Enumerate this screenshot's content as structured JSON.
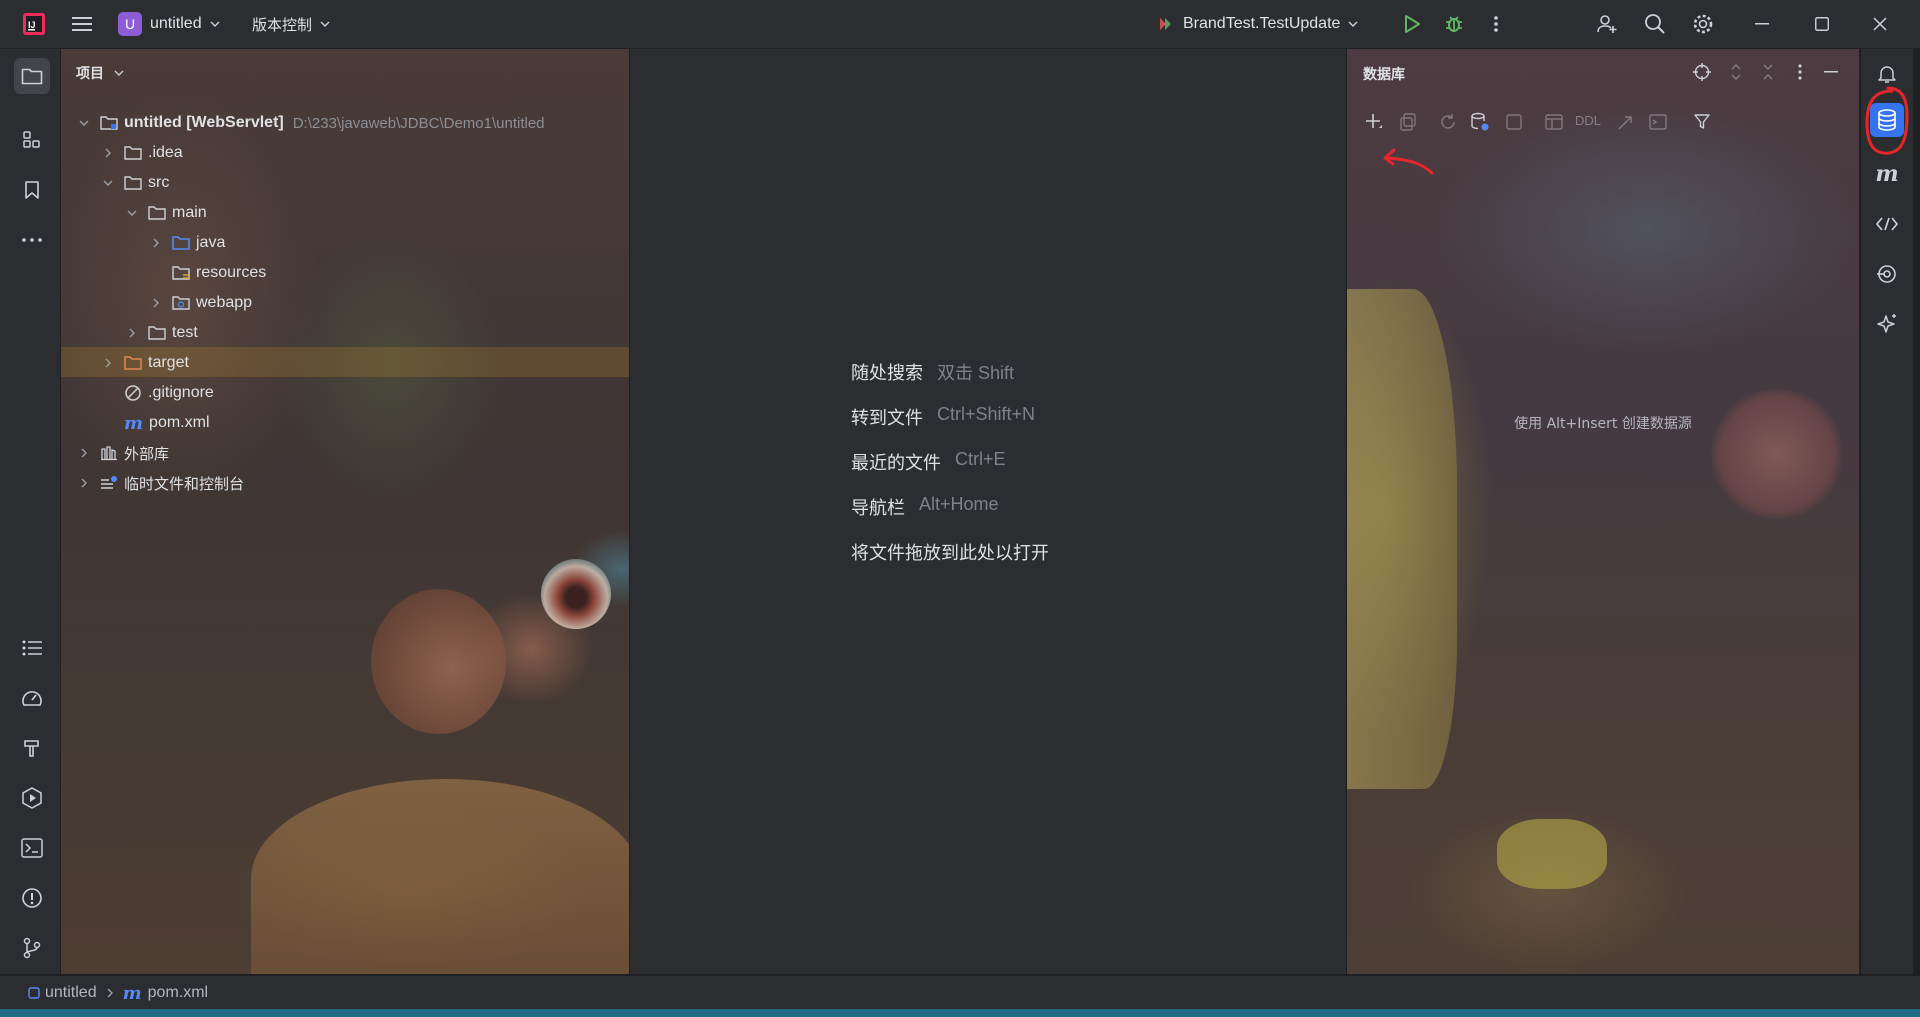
{
  "titlebar": {
    "project_badge": "U",
    "project_name": "untitled",
    "vcs_label": "版本控制",
    "run_config": "BrandTest.TestUpdate"
  },
  "project_panel": {
    "title": "项目",
    "tree": [
      {
        "label": "untitled [WebServlet]",
        "path": "D:\\233\\javaweb\\JDBC\\Demo1\\untitled"
      },
      {
        "label": ".idea"
      },
      {
        "label": "src"
      },
      {
        "label": "main"
      },
      {
        "label": "java"
      },
      {
        "label": "resources"
      },
      {
        "label": "webapp"
      },
      {
        "label": "test"
      },
      {
        "label": "target"
      },
      {
        "label": ".gitignore"
      },
      {
        "label": "pom.xml"
      },
      {
        "label": "外部库"
      },
      {
        "label": "临时文件和控制台"
      }
    ]
  },
  "editor_hints": [
    {
      "label": "随处搜索",
      "key": "双击 Shift"
    },
    {
      "label": "转到文件",
      "key": "Ctrl+Shift+N"
    },
    {
      "label": "最近的文件",
      "key": "Ctrl+E"
    },
    {
      "label": "导航栏",
      "key": "Alt+Home"
    },
    {
      "label": "将文件拖放到此处以打开",
      "key": ""
    }
  ],
  "db_panel": {
    "title": "数据库",
    "ddl_label": "DDL",
    "empty_text": "使用 Alt+Insert 创建数据源"
  },
  "statusbar": {
    "breadcrumb_project": "untitled",
    "breadcrumb_file": "pom.xml"
  },
  "colors": {
    "accent": "#3574f0",
    "run_green": "#5fb865",
    "annotation_red": "#e5262a",
    "badge_purple": "#8e5dd6"
  },
  "icons": [
    "app-logo-icon",
    "hamburger-menu-icon",
    "run-icon",
    "debug-icon",
    "more-vertical-icon",
    "add-user-icon",
    "search-icon",
    "gear-icon",
    "minimize-icon",
    "maximize-icon",
    "close-icon",
    "folder-icon",
    "structure-icon",
    "bookmark-icon",
    "more-horizontal-icon",
    "todo-list-icon",
    "profiler-icon",
    "build-icon",
    "services-icon",
    "terminal-icon",
    "problems-icon",
    "git-icon",
    "bell-icon",
    "database-icon",
    "maven-icon",
    "endpoints-icon",
    "persistence-icon",
    "ai-assistant-icon",
    "crosshair-icon",
    "expand-collapse-icon",
    "add-icon",
    "filter-icon"
  ]
}
